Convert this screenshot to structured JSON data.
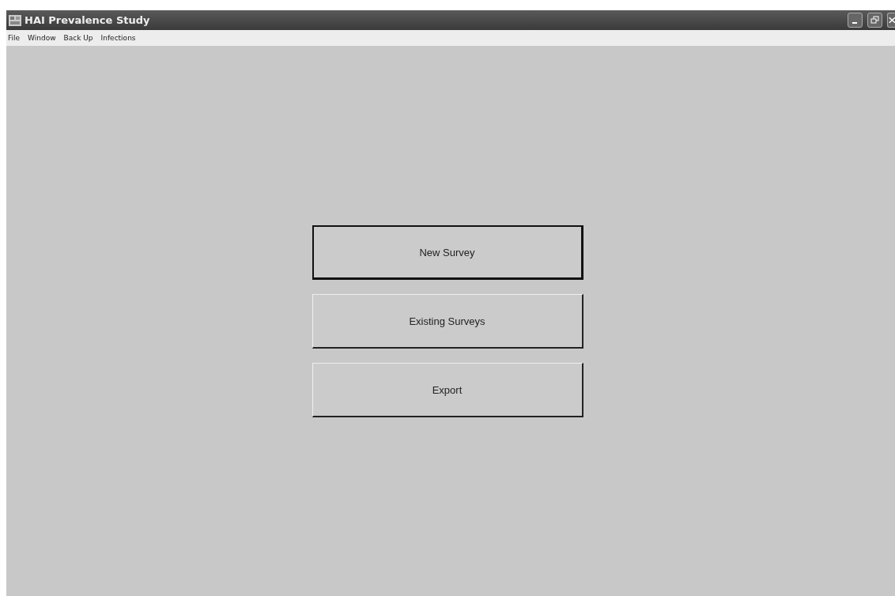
{
  "window": {
    "title": "HAI Prevalence Study"
  },
  "menu": [
    "File",
    "Window",
    "Back Up",
    "Infections"
  ],
  "buttons": [
    {
      "label": "New Survey",
      "focused": true
    },
    {
      "label": "Existing Surveys",
      "focused": false
    },
    {
      "label": "Export",
      "focused": false
    }
  ]
}
